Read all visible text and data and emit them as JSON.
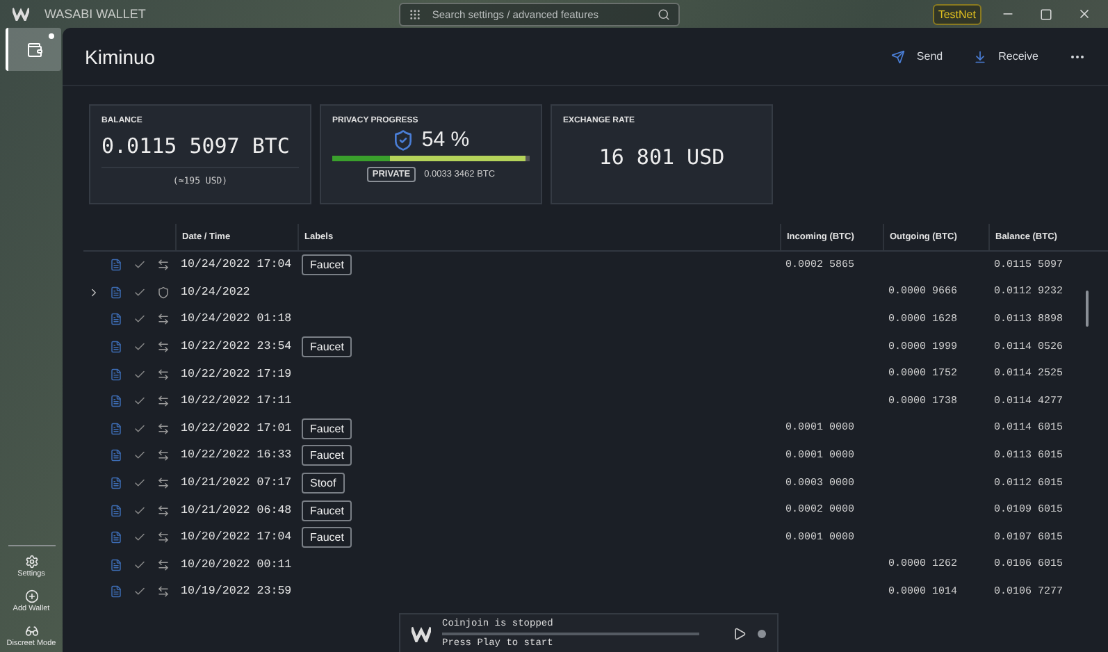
{
  "app": {
    "title": "WASABI WALLET",
    "search": {
      "placeholder": "Search settings / advanced features"
    },
    "network_badge": "TestNet"
  },
  "sidebar": {
    "wallet_selected": true,
    "items": [
      {
        "kind": "settings",
        "label": "Settings"
      },
      {
        "kind": "add",
        "label": "Add Wallet"
      },
      {
        "kind": "discreet",
        "label": "Discreet Mode"
      }
    ]
  },
  "header": {
    "wallet_name": "Kiminuo",
    "actions": [
      {
        "kind": "send",
        "label": "Send"
      },
      {
        "kind": "receive",
        "label": "Receive"
      }
    ]
  },
  "cards": {
    "balance": {
      "title": "BALANCE",
      "btc": "0.0115 5097 BTC",
      "usd": "(≈195 USD)"
    },
    "privacy": {
      "title": "PRIVACY PROGRESS",
      "percent": "54 %",
      "level": 0.98,
      "badge": "PRIVATE",
      "amount": "0.0033 3462 BTC"
    },
    "exchange": {
      "title": "EXCHANGE RATE",
      "value": "16 801 USD"
    }
  },
  "table": {
    "columns": [
      "Date / Time",
      "Labels",
      "Incoming (BTC)",
      "Outgoing (BTC)",
      "Balance (BTC)"
    ],
    "rows": [
      {
        "kind": "transaction",
        "date": "10/24/2022 17:04",
        "label": "Faucet",
        "incoming": "0.0002 5865",
        "balance": "0.0115 5097"
      },
      {
        "kind": "coinjoin",
        "date": "10/24/2022",
        "outgoing": "0.0000 9666",
        "balance": "0.0112 9232"
      },
      {
        "kind": "transaction",
        "date": "10/24/2022 01:18",
        "outgoing": "0.0000 1628",
        "balance": "0.0113 8898"
      },
      {
        "kind": "transaction",
        "date": "10/22/2022 23:54",
        "label": "Faucet",
        "outgoing": "0.0000 1999",
        "balance": "0.0114 0526"
      },
      {
        "kind": "transaction",
        "date": "10/22/2022 17:19",
        "outgoing": "0.0000 1752",
        "balance": "0.0114 2525"
      },
      {
        "kind": "transaction",
        "date": "10/22/2022 17:11",
        "outgoing": "0.0000 1738",
        "balance": "0.0114 4277"
      },
      {
        "kind": "transaction",
        "date": "10/22/2022 17:01",
        "label": "Faucet",
        "incoming": "0.0001 0000",
        "balance": "0.0114 6015"
      },
      {
        "kind": "transaction",
        "date": "10/22/2022 16:33",
        "label": "Faucet",
        "incoming": "0.0001 0000",
        "balance": "0.0113 6015"
      },
      {
        "kind": "transaction",
        "date": "10/21/2022 07:17",
        "label": "Stoof",
        "incoming": "0.0003 0000",
        "balance": "0.0112 6015"
      },
      {
        "kind": "transaction",
        "date": "10/21/2022 06:48",
        "label": "Faucet",
        "incoming": "0.0002 0000",
        "balance": "0.0109 6015"
      },
      {
        "kind": "transaction",
        "date": "10/20/2022 17:04",
        "label": "Faucet",
        "incoming": "0.0001 0000",
        "balance": "0.0107 6015"
      },
      {
        "kind": "transaction",
        "date": "10/20/2022 00:11",
        "outgoing": "0.0000 1262",
        "balance": "0.0106 6015"
      },
      {
        "kind": "transaction",
        "date": "10/19/2022 23:59",
        "outgoing": "0.0000 1014",
        "balance": "0.0106 7277"
      }
    ]
  },
  "coinjoin": {
    "status": "Coinjoin is stopped",
    "hint": "Press Play to start"
  }
}
